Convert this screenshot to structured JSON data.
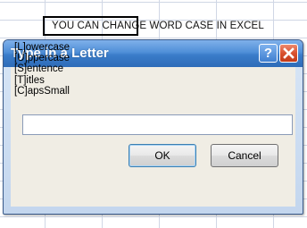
{
  "sheet": {
    "cell_text": "YOU CAN CHANGE WORD CASE IN EXCEL"
  },
  "dialog": {
    "title": "Type in a Letter",
    "help_label": "?",
    "prompt_lines": [
      "[L]owercase",
      "[U]ppercase",
      "[S]entence",
      "[T]itles",
      "[C]apsSmall"
    ],
    "input_value": "",
    "ok_label": "OK",
    "cancel_label": "Cancel"
  },
  "colors": {
    "titlebar": "#3a7cc9",
    "close_button": "#d8512f",
    "gridline": "#d0d7e5",
    "dialog_body": "#f0ede4"
  },
  "icons": {
    "help": "question-mark-icon",
    "close": "close-x-icon"
  }
}
